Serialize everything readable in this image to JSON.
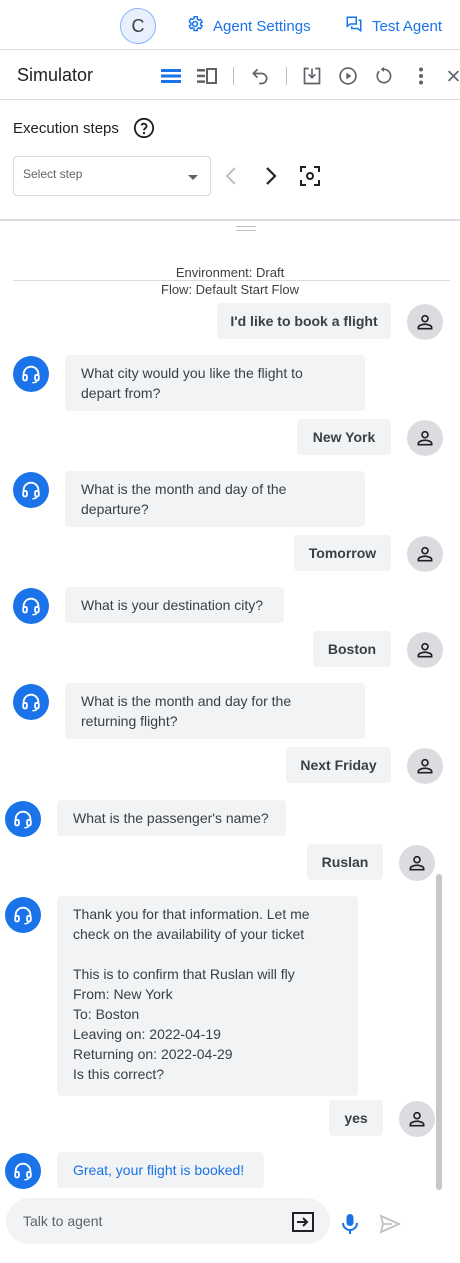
{
  "topbar": {
    "avatar_letter": "C",
    "agent_settings_label": "Agent Settings",
    "test_agent_label": "Test Agent"
  },
  "simulator": {
    "title": "Simulator"
  },
  "execution": {
    "label": "Execution steps",
    "select_placeholder": "Select step"
  },
  "environment": {
    "env_text": "Environment: Draft",
    "flow_text": "Flow: Default Start Flow"
  },
  "messages": [
    {
      "role": "user",
      "text": "I'd like to book a flight"
    },
    {
      "role": "agent",
      "lines": [
        "What city would you like the flight to",
        "depart from?"
      ]
    },
    {
      "role": "user",
      "text": "New York"
    },
    {
      "role": "agent",
      "lines": [
        "What is the month and day of the",
        "departure?"
      ]
    },
    {
      "role": "user",
      "text": "Tomorrow"
    },
    {
      "role": "agent",
      "lines": [
        "What is your destination city?"
      ]
    },
    {
      "role": "user",
      "text": "Boston"
    },
    {
      "role": "agent",
      "lines": [
        "What is the month and day for the",
        "returning flight?"
      ]
    },
    {
      "role": "user",
      "text": "Next Friday"
    },
    {
      "role": "agent",
      "lines": [
        "What is the passenger's name?"
      ]
    },
    {
      "role": "user",
      "text": "Ruslan"
    },
    {
      "role": "agent",
      "lines": [
        "Thank you for that information. Let me",
        "check on the availability of your ticket",
        "",
        "This is to confirm that Ruslan will fly",
        "From: New York",
        "To: Boston",
        "Leaving on: 2022-04-19",
        "Returning on: 2022-04-29",
        "Is this correct?"
      ]
    },
    {
      "role": "user",
      "text": "yes"
    },
    {
      "role": "agent",
      "lines": [
        "Great, your flight is booked!"
      ]
    }
  ],
  "input": {
    "placeholder": "Talk to agent"
  },
  "colors": {
    "accent": "#1a73e8",
    "bubble_bg": "#f1f3f4",
    "user_avatar_bg": "#dadce0"
  }
}
